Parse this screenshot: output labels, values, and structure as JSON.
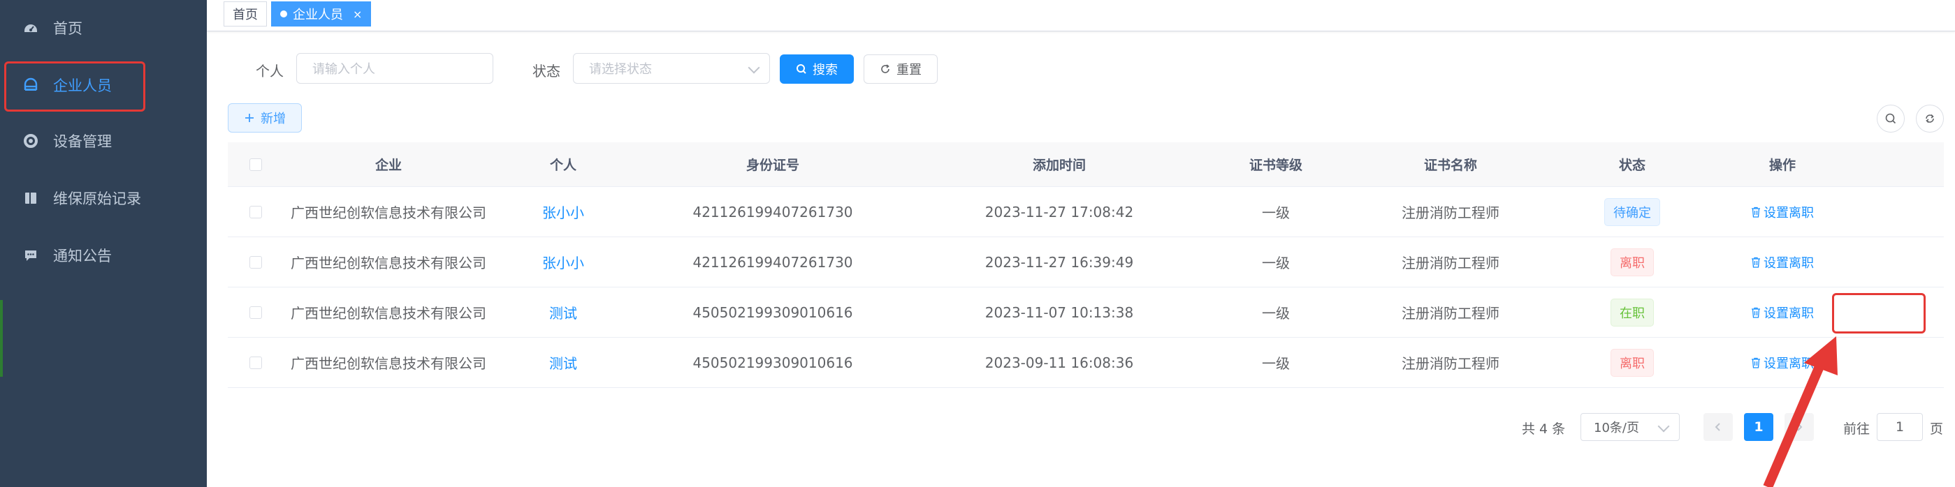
{
  "sidebar": {
    "items": [
      {
        "label": "首页",
        "icon": "dashboard-icon",
        "active": false
      },
      {
        "label": "企业人员",
        "icon": "people-icon",
        "active": true
      },
      {
        "label": "设备管理",
        "icon": "device-icon",
        "active": false
      },
      {
        "label": "维保原始记录",
        "icon": "book-icon",
        "active": false
      },
      {
        "label": "通知公告",
        "icon": "message-icon",
        "active": false
      }
    ]
  },
  "tags": [
    {
      "label": "首页",
      "active": false
    },
    {
      "label": "企业人员",
      "active": true,
      "close": "×"
    }
  ],
  "filter": {
    "person_label": "个人",
    "person_placeholder": "请输入个人",
    "status_label": "状态",
    "status_placeholder": "请选择状态",
    "search_label": "搜索",
    "reset_label": "重置"
  },
  "toolbar": {
    "add_label": "新增",
    "search_icon": "search-icon",
    "refresh_icon": "refresh-icon"
  },
  "table": {
    "headers": [
      "企业",
      "个人",
      "身份证号",
      "添加时间",
      "证书等级",
      "证书名称",
      "状态",
      "操作"
    ],
    "rows": [
      {
        "company": "广西世纪创软信息技术有限公司",
        "person": "张小小",
        "id": "421126199407261730",
        "time": "2023-11-27 17:08:42",
        "level": "一级",
        "cert": "注册消防工程师",
        "status": "待确定",
        "status_type": "info",
        "action": "设置离职"
      },
      {
        "company": "广西世纪创软信息技术有限公司",
        "person": "张小小",
        "id": "421126199407261730",
        "time": "2023-11-27 16:39:49",
        "level": "一级",
        "cert": "注册消防工程师",
        "status": "离职",
        "status_type": "danger",
        "action": "设置离职"
      },
      {
        "company": "广西世纪创软信息技术有限公司",
        "person": "测试",
        "id": "450502199309010616",
        "time": "2023-11-07 10:13:38",
        "level": "一级",
        "cert": "注册消防工程师",
        "status": "在职",
        "status_type": "success",
        "action": "设置离职"
      },
      {
        "company": "广西世纪创软信息技术有限公司",
        "person": "测试",
        "id": "450502199309010616",
        "time": "2023-09-11 16:08:36",
        "level": "一级",
        "cert": "注册消防工程师",
        "status": "离职",
        "status_type": "danger",
        "action": "设置离职"
      }
    ]
  },
  "pagination": {
    "total": "共 4 条",
    "page_size": "10条/页",
    "current_page": "1",
    "goto_label": "前往",
    "goto_value": "1",
    "page_suffix": "页"
  },
  "colors": {
    "sidebar_bg": "#304156",
    "primary": "#1890ff",
    "annotation": "#e53935"
  }
}
